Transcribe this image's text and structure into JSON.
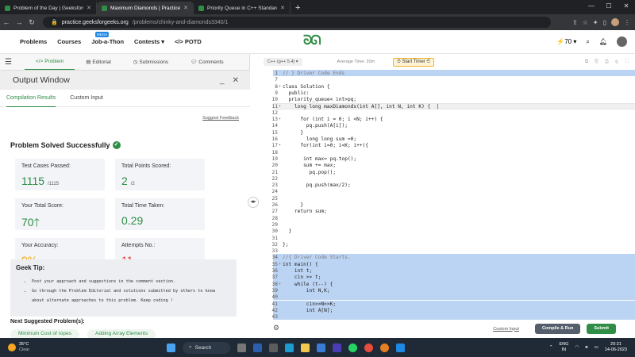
{
  "browser": {
    "tabs": [
      {
        "title": "Problem of the Day | GeeksforGee",
        "active": false
      },
      {
        "title": "Maximum Diamonds | Practice | G",
        "active": true
      },
      {
        "title": "Priority Queue in C++ Standard",
        "active": false
      }
    ],
    "url_host": "practice.geeksforgeeks.org",
    "url_path": "/problems/chinky-and-diamonds3340/1"
  },
  "site": {
    "nav": [
      "Problems",
      "Courses",
      "Job-a-Thon",
      "Contests",
      "POTD"
    ],
    "mega_badge": "MEGA",
    "logo": "GfG",
    "streak": "70"
  },
  "left": {
    "tabs": [
      "Problem",
      "Editorial",
      "Submissions",
      "Comments"
    ],
    "output_title": "Output Window",
    "output_tabs": [
      "Compilation Results",
      "Custom Input"
    ],
    "suggest_feedback": "Suggest Feedback",
    "status": "Problem Solved Successfully",
    "cards": {
      "tests_label": "Test Cases Passed:",
      "tests_value": "1115",
      "tests_total": "/1115",
      "points_label": "Total Points Scored:",
      "points_value": "2",
      "points_total": "/2",
      "score_label": "Your Total Score:",
      "score_value": "70",
      "time_label": "Total Time Taken:",
      "time_value": "0.29",
      "acc_label": "Your Accuracy:",
      "acc_value": "9%",
      "attempts_label": "Attempts No.:",
      "attempts_value": "11"
    },
    "tip_title": "Geek Tip:",
    "tips": [
      "Post your approach and suggestions in the comment section.",
      "Go through the Problem Editorial and solutions submitted by others to know",
      "about alternate approaches to this problem. Keep coding !"
    ],
    "next_title": "Next Suggested Problem(s):",
    "next": [
      "Minimum Cost of ropes",
      "Adding Array Elements"
    ]
  },
  "editor": {
    "language": "C++ (g++ 5.4)",
    "avg_time": "Average Time: 20m",
    "timer": "Start Timer",
    "custom_input": "Custom Input",
    "compile_btn": "Compile & Run",
    "submit_btn": "Submit",
    "lines": [
      {
        "n": "1",
        "t": "// } Driver Code Ends"
      },
      {
        "n": "7",
        "t": ""
      },
      {
        "n": "8",
        "t": "class Solution {"
      },
      {
        "n": "9",
        "t": "  public:"
      },
      {
        "n": "10",
        "t": "  priority_queue< int>pq;"
      },
      {
        "n": "11",
        "t": "    long long maxDiamonds(int A[], int N, int K) {  |"
      },
      {
        "n": "12",
        "t": ""
      },
      {
        "n": "13",
        "t": "      for (int i = 0; i <N; i++) {"
      },
      {
        "n": "14",
        "t": "        pq.push(A[i]);"
      },
      {
        "n": "15",
        "t": "      }"
      },
      {
        "n": "16",
        "t": "        long long sum =0;"
      },
      {
        "n": "17",
        "t": "      for(int i=0; i<K; i++){"
      },
      {
        "n": "18",
        "t": ""
      },
      {
        "n": "19",
        "t": "       int max= pq.top();"
      },
      {
        "n": "20",
        "t": "       sum += max;"
      },
      {
        "n": "21",
        "t": "         pq.pop();"
      },
      {
        "n": "22",
        "t": ""
      },
      {
        "n": "23",
        "t": "        pq.push(max/2);"
      },
      {
        "n": "24",
        "t": ""
      },
      {
        "n": "25",
        "t": ""
      },
      {
        "n": "26",
        "t": "      }"
      },
      {
        "n": "27",
        "t": "    return sum;"
      },
      {
        "n": "28",
        "t": ""
      },
      {
        "n": "29",
        "t": ""
      },
      {
        "n": "30",
        "t": "  }"
      },
      {
        "n": "31",
        "t": ""
      },
      {
        "n": "32",
        "t": "};"
      },
      {
        "n": "33",
        "t": ""
      },
      {
        "n": "34",
        "t": "//{ Driver Code Starts."
      },
      {
        "n": "35",
        "t": "int main() {"
      },
      {
        "n": "36",
        "t": "    int t;"
      },
      {
        "n": "37",
        "t": "    cin >> t;"
      },
      {
        "n": "38",
        "t": "    while (t--) {"
      },
      {
        "n": "39",
        "t": "        int N,K;"
      },
      {
        "n": "40",
        "t": ""
      },
      {
        "n": "41",
        "t": "        cin>>N>>K;"
      },
      {
        "n": "42",
        "t": "        int A[N];"
      },
      {
        "n": "43",
        "t": ""
      }
    ]
  },
  "taskbar": {
    "temp": "35°C",
    "cond": "Clear",
    "search": "Search",
    "lang1": "ENG",
    "lang2": "IN",
    "time": "20:21",
    "date": "14-06-2023"
  },
  "colors": {
    "brand": "#2f8d46",
    "submit": "#2f8d46",
    "compile": "#555f6b"
  }
}
